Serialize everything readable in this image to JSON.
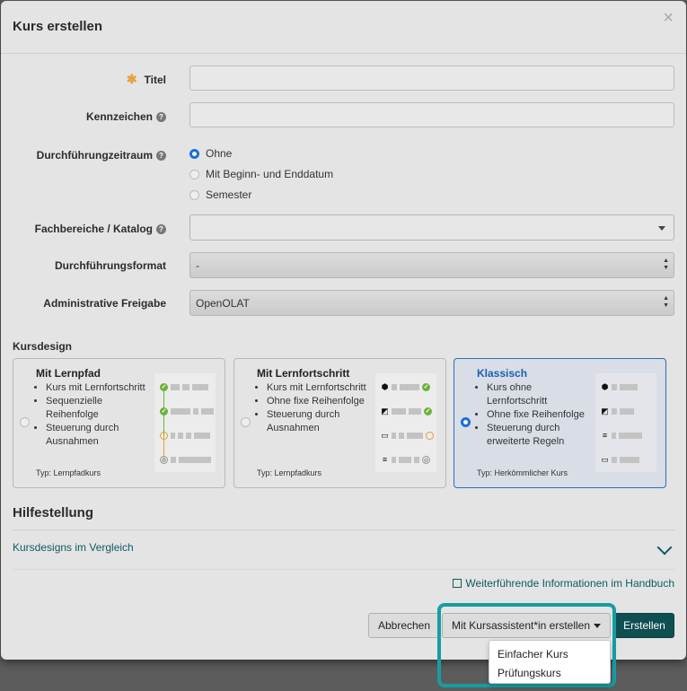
{
  "modal": {
    "title": "Kurs erstellen",
    "close": "×"
  },
  "form": {
    "title_label": "Titel",
    "kennzeichen_label": "Kennzeichen",
    "zeitraum_label": "Durchführungzeitraum",
    "zeitraum_options": [
      "Ohne",
      "Mit Beginn- und Enddatum",
      "Semester"
    ],
    "zeitraum_selected": "Ohne",
    "fachbereiche_label": "Fachbereiche / Katalog",
    "format_label": "Durchführungsformat",
    "format_value": "-",
    "freigabe_label": "Administrative Freigabe",
    "freigabe_value": "OpenOLAT",
    "help_glyph": "?"
  },
  "kursdesign": {
    "label": "Kursdesign",
    "cards": [
      {
        "title": "Mit Lernpfad",
        "bullets": [
          "Kurs mit Lernfortschritt",
          "Sequenzielle Reihenfolge",
          "Steuerung durch Ausnahmen"
        ],
        "type": "Typ: Lernpfadkurs",
        "selected": false
      },
      {
        "title": "Mit Lernfortschritt",
        "bullets": [
          "Kurs mit Lernfortschritt",
          "Ohne fixe Reihenfolge",
          "Steuerung durch Ausnahmen"
        ],
        "type": "Typ: Lernpfadkurs",
        "selected": false
      },
      {
        "title": "Klassisch",
        "bullets": [
          "Kurs ohne Lernfortschritt",
          "Ohne fixe Reihenfolge",
          "Steuerung durch erweiterte Regeln"
        ],
        "type": "Typ: Herkömmlicher Kurs",
        "selected": true
      }
    ]
  },
  "hilfe": {
    "title": "Hilfestellung",
    "vergleich_link": "Kursdesigns im Vergleich",
    "handbuch_link": "Weiterführende Informationen im Handbuch"
  },
  "footer": {
    "abbrechen": "Abbrechen",
    "assistent": "Mit Kursassistent*in erstellen",
    "erstellen": "Erstellen",
    "dropdown_items": [
      "Einfacher Kurs",
      "Prüfungskurs"
    ]
  },
  "colors": {
    "primary": "#0f4f52",
    "accent_link": "#0f5a63",
    "highlight": "#149ea3",
    "selected_radio": "#1a6fd6"
  }
}
